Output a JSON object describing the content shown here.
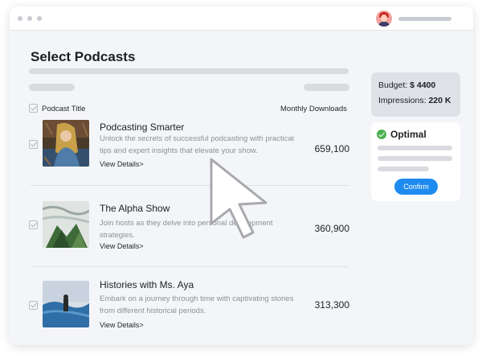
{
  "page": {
    "title": "Select Podcasts"
  },
  "table": {
    "col_title": "Podcast Title",
    "col_downloads": "Monthly Downloads"
  },
  "podcasts": [
    {
      "title": "Podcasting Smarter",
      "description": "Unlock the secrets of successful podcasting with practical tips and expert insights that elevate your show.",
      "link": "View Details>",
      "downloads": "659,100"
    },
    {
      "title": "The Alpha Show",
      "description": "Join hosts as they delve into personal development strategies.",
      "link": "View Details>",
      "downloads": "360,900"
    },
    {
      "title": "Histories with Ms. Aya",
      "description": "Embark on a journey through time with captivating stories from different historical periods.",
      "link": "View Details>",
      "downloads": "313,300"
    }
  ],
  "summary": {
    "budget_label": "Budget:",
    "budget_value": "$ 4400",
    "impressions_label": "Impressions:",
    "impressions_value": "220 K"
  },
  "optimal": {
    "title": "Optimal",
    "confirm_label": "Confirm"
  },
  "colors": {
    "accent": "#1e8bf0",
    "success": "#4caf50"
  },
  "icons": [
    "avatar-icon",
    "check-circle-icon",
    "checkbox-icon",
    "cursor-arrow-icon"
  ]
}
